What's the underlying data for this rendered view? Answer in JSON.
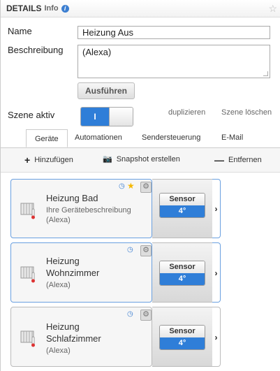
{
  "header": {
    "title": "DETAILS",
    "subtitle": "Info",
    "info_icon": "i"
  },
  "form": {
    "name_label": "Name",
    "name_value": "Heizung Aus",
    "desc_label": "Beschreibung",
    "desc_value": "(Alexa)",
    "run_label": "Ausführen",
    "scene_label": "Szene aktiv",
    "toggle_on_text": "I",
    "duplicate_label": "duplizieren",
    "delete_label": "Szene löschen"
  },
  "tabs": [
    {
      "label": "Geräte"
    },
    {
      "label": "Automationen"
    },
    {
      "label": "Sendersteuerung"
    },
    {
      "label": "E-Mail"
    }
  ],
  "toolbar": {
    "add_label": "Hinzufügen",
    "snapshot_label": "Snapshot erstellen",
    "remove_label": "Entfernen"
  },
  "devices": [
    {
      "name": "Heizung Bad",
      "desc": "Ihre Gerätebeschreibung",
      "sub": "(Alexa)",
      "sensor_label": "Sensor",
      "sensor_value": "4°",
      "favorite": true
    },
    {
      "name": "Heizung Wohnzimmer",
      "name_line1": "Heizung",
      "name_line2": "Wohnzimmer",
      "sub": "(Alexa)",
      "sensor_label": "Sensor",
      "sensor_value": "4°"
    },
    {
      "name": "Heizung Schlafzimmer",
      "name_line1": "Heizung",
      "name_line2": "Schlafzimmer",
      "sub": "(Alexa)",
      "sensor_label": "Sensor",
      "sensor_value": "4°"
    }
  ],
  "colors": {
    "accent": "#2f7ed8",
    "card_border": "#6aa0e0",
    "favorite": "#f5b800"
  }
}
